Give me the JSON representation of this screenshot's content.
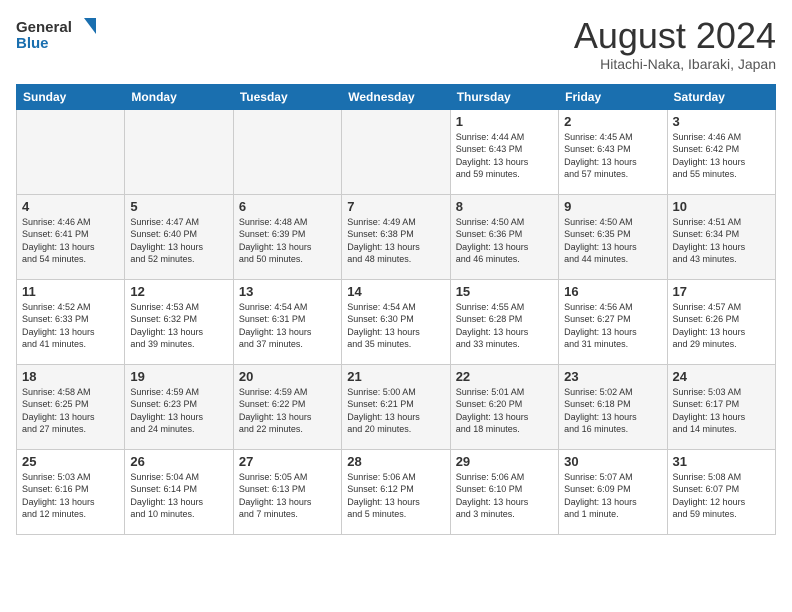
{
  "header": {
    "logo_line1": "General",
    "logo_line2": "Blue",
    "month_title": "August 2024",
    "location": "Hitachi-Naka, Ibaraki, Japan"
  },
  "weekdays": [
    "Sunday",
    "Monday",
    "Tuesday",
    "Wednesday",
    "Thursday",
    "Friday",
    "Saturday"
  ],
  "weeks": [
    {
      "days": [
        {
          "num": "",
          "info": ""
        },
        {
          "num": "",
          "info": ""
        },
        {
          "num": "",
          "info": ""
        },
        {
          "num": "",
          "info": ""
        },
        {
          "num": "1",
          "info": "Sunrise: 4:44 AM\nSunset: 6:43 PM\nDaylight: 13 hours\nand 59 minutes."
        },
        {
          "num": "2",
          "info": "Sunrise: 4:45 AM\nSunset: 6:43 PM\nDaylight: 13 hours\nand 57 minutes."
        },
        {
          "num": "3",
          "info": "Sunrise: 4:46 AM\nSunset: 6:42 PM\nDaylight: 13 hours\nand 55 minutes."
        }
      ]
    },
    {
      "days": [
        {
          "num": "4",
          "info": "Sunrise: 4:46 AM\nSunset: 6:41 PM\nDaylight: 13 hours\nand 54 minutes."
        },
        {
          "num": "5",
          "info": "Sunrise: 4:47 AM\nSunset: 6:40 PM\nDaylight: 13 hours\nand 52 minutes."
        },
        {
          "num": "6",
          "info": "Sunrise: 4:48 AM\nSunset: 6:39 PM\nDaylight: 13 hours\nand 50 minutes."
        },
        {
          "num": "7",
          "info": "Sunrise: 4:49 AM\nSunset: 6:38 PM\nDaylight: 13 hours\nand 48 minutes."
        },
        {
          "num": "8",
          "info": "Sunrise: 4:50 AM\nSunset: 6:36 PM\nDaylight: 13 hours\nand 46 minutes."
        },
        {
          "num": "9",
          "info": "Sunrise: 4:50 AM\nSunset: 6:35 PM\nDaylight: 13 hours\nand 44 minutes."
        },
        {
          "num": "10",
          "info": "Sunrise: 4:51 AM\nSunset: 6:34 PM\nDaylight: 13 hours\nand 43 minutes."
        }
      ]
    },
    {
      "days": [
        {
          "num": "11",
          "info": "Sunrise: 4:52 AM\nSunset: 6:33 PM\nDaylight: 13 hours\nand 41 minutes."
        },
        {
          "num": "12",
          "info": "Sunrise: 4:53 AM\nSunset: 6:32 PM\nDaylight: 13 hours\nand 39 minutes."
        },
        {
          "num": "13",
          "info": "Sunrise: 4:54 AM\nSunset: 6:31 PM\nDaylight: 13 hours\nand 37 minutes."
        },
        {
          "num": "14",
          "info": "Sunrise: 4:54 AM\nSunset: 6:30 PM\nDaylight: 13 hours\nand 35 minutes."
        },
        {
          "num": "15",
          "info": "Sunrise: 4:55 AM\nSunset: 6:28 PM\nDaylight: 13 hours\nand 33 minutes."
        },
        {
          "num": "16",
          "info": "Sunrise: 4:56 AM\nSunset: 6:27 PM\nDaylight: 13 hours\nand 31 minutes."
        },
        {
          "num": "17",
          "info": "Sunrise: 4:57 AM\nSunset: 6:26 PM\nDaylight: 13 hours\nand 29 minutes."
        }
      ]
    },
    {
      "days": [
        {
          "num": "18",
          "info": "Sunrise: 4:58 AM\nSunset: 6:25 PM\nDaylight: 13 hours\nand 27 minutes."
        },
        {
          "num": "19",
          "info": "Sunrise: 4:59 AM\nSunset: 6:23 PM\nDaylight: 13 hours\nand 24 minutes."
        },
        {
          "num": "20",
          "info": "Sunrise: 4:59 AM\nSunset: 6:22 PM\nDaylight: 13 hours\nand 22 minutes."
        },
        {
          "num": "21",
          "info": "Sunrise: 5:00 AM\nSunset: 6:21 PM\nDaylight: 13 hours\nand 20 minutes."
        },
        {
          "num": "22",
          "info": "Sunrise: 5:01 AM\nSunset: 6:20 PM\nDaylight: 13 hours\nand 18 minutes."
        },
        {
          "num": "23",
          "info": "Sunrise: 5:02 AM\nSunset: 6:18 PM\nDaylight: 13 hours\nand 16 minutes."
        },
        {
          "num": "24",
          "info": "Sunrise: 5:03 AM\nSunset: 6:17 PM\nDaylight: 13 hours\nand 14 minutes."
        }
      ]
    },
    {
      "days": [
        {
          "num": "25",
          "info": "Sunrise: 5:03 AM\nSunset: 6:16 PM\nDaylight: 13 hours\nand 12 minutes."
        },
        {
          "num": "26",
          "info": "Sunrise: 5:04 AM\nSunset: 6:14 PM\nDaylight: 13 hours\nand 10 minutes."
        },
        {
          "num": "27",
          "info": "Sunrise: 5:05 AM\nSunset: 6:13 PM\nDaylight: 13 hours\nand 7 minutes."
        },
        {
          "num": "28",
          "info": "Sunrise: 5:06 AM\nSunset: 6:12 PM\nDaylight: 13 hours\nand 5 minutes."
        },
        {
          "num": "29",
          "info": "Sunrise: 5:06 AM\nSunset: 6:10 PM\nDaylight: 13 hours\nand 3 minutes."
        },
        {
          "num": "30",
          "info": "Sunrise: 5:07 AM\nSunset: 6:09 PM\nDaylight: 13 hours\nand 1 minute."
        },
        {
          "num": "31",
          "info": "Sunrise: 5:08 AM\nSunset: 6:07 PM\nDaylight: 12 hours\nand 59 minutes."
        }
      ]
    }
  ]
}
